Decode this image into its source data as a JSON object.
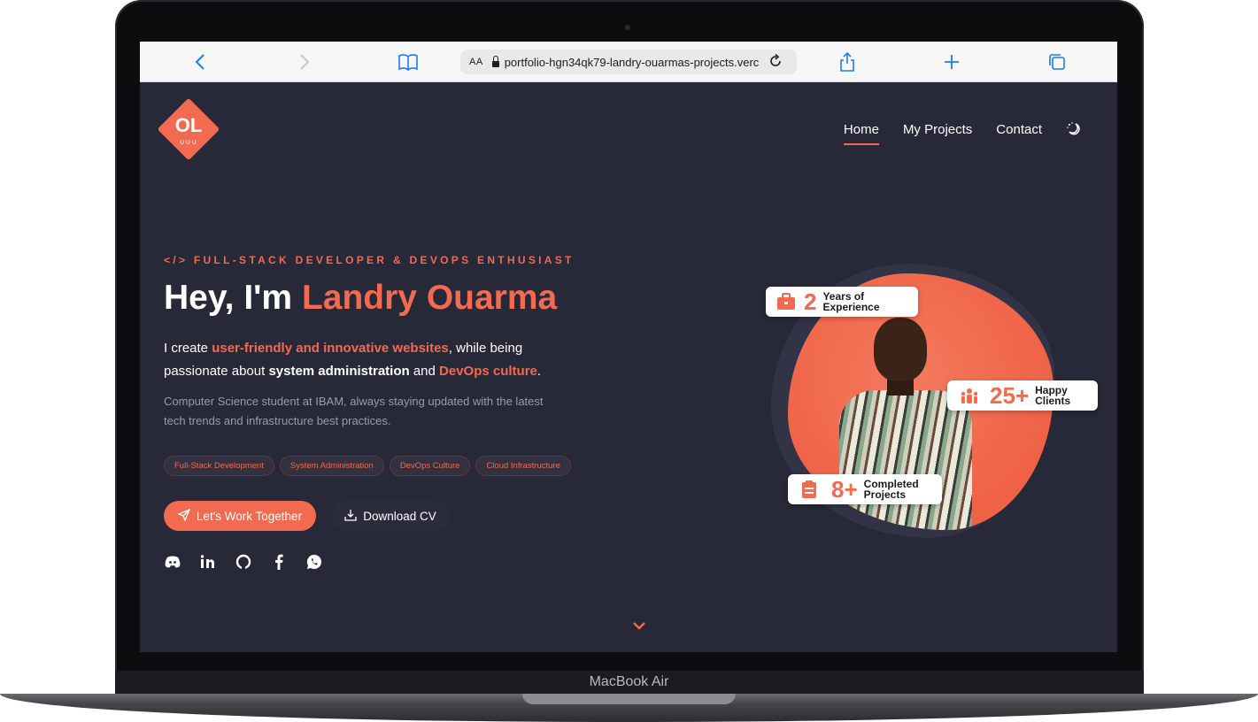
{
  "device": {
    "label": "MacBook Air"
  },
  "browser": {
    "url": "portfolio-hgn34qk79-landry-ouarmas-projects.verc",
    "text_size_label": "AA"
  },
  "logo": {
    "initials": "OL",
    "sub": "∪∪∪"
  },
  "nav": {
    "items": [
      "Home",
      "My Projects",
      "Contact"
    ],
    "active": "Home"
  },
  "hero": {
    "eyebrow": "</> FULL-STACK DEVELOPER & DEVOPS ENTHUSIAST",
    "greeting": "Hey, I'm ",
    "name": "Landry Ouarma",
    "lead": {
      "p1": "I create ",
      "h1": "user-friendly and innovative websites",
      "p2": ", while being passionate about ",
      "h2": "system administration",
      "p3": " and ",
      "h3": "DevOps culture",
      "p4": "."
    },
    "description": "Computer Science student at IBAM, always staying updated with the latest tech trends and infrastructure best practices.",
    "tags": [
      "Full-Stack Development",
      "System Administration",
      "DevOps Culture",
      "Cloud Infrastructure"
    ],
    "cta_primary": "Let's Work Together",
    "cta_secondary": "Download CV",
    "socials": [
      "discord-icon",
      "linkedin-icon",
      "github-icon",
      "facebook-icon",
      "whatsapp-icon"
    ]
  },
  "stats": {
    "experience": {
      "value": "2",
      "label1": "Years of",
      "label2": "Experience"
    },
    "clients": {
      "value": "25+",
      "label1": "Happy",
      "label2": "Clients"
    },
    "projects": {
      "value": "8+",
      "label1": "Completed",
      "label2": "Projects"
    }
  },
  "colors": {
    "accent": "#f26a50",
    "background": "#272838"
  }
}
